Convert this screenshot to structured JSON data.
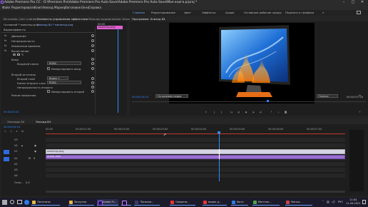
{
  "window": {
    "title": "Adobe Premiere Pro CC - D:\\Premiere Pro\\Adobe Premiere Pro Auto-Save\\Adobe Premiere Pro Auto-Save\\Моя книга.prproj *"
  },
  "menu": [
    "Файл",
    "Редактировать",
    "Клип",
    "Эпизод",
    "Маркер",
    "Заголовок",
    "Окно",
    "Справка"
  ],
  "workspaces": [
    "Главная",
    "Редактирование",
    "Цвет",
    "Эффекты",
    "Аудио",
    "Основные рабочие среды",
    "Подписи и графика"
  ],
  "left_panel": {
    "top_tabs": [
      "Источник: (нет клипов)",
      "Элементы управления эффектами",
      "Микшер аудиоклипов: Эпизод 84"
    ],
    "sub_tabs": [
      "Основной * монитор.png",
      "Эпизод 84 * монитор.png"
    ],
    "clip_label": "монитор.png",
    "ruler_time": "00:00",
    "section": "Видеоэффекты",
    "effects": [
      {
        "name": "Движение"
      },
      {
        "name": "Непрозрачность"
      },
      {
        "name": "Изменение времени"
      },
      {
        "name": "Вычисления"
      }
    ],
    "sub_effect_label": "Вход",
    "fields": [
      {
        "label": "Входной канал",
        "value": "RGBA"
      },
      {
        "label": "Инвертировать вход",
        "value": ""
      },
      {
        "label": "Второй источник",
        "value": ""
      },
      {
        "label": "Второй слой",
        "value": "Видео 1"
      },
      {
        "label": "Канал второго слоя",
        "value": "RGBA"
      },
      {
        "label": "Непрозрачность второго",
        "value": ""
      },
      {
        "label": "Инвертировать второй",
        "value": ""
      }
    ],
    "blend_mode": "Режим наложения",
    "bottom_time": "00:00:04:10"
  },
  "program_monitor": {
    "tab": "Программа: Эпизод 84",
    "timecode": "00:00:04:10",
    "fit": "По размеру кадра",
    "quality": "Полное",
    "duration": "00:00:07:20"
  },
  "timeline": {
    "tabs": [
      "Эпизоды 84",
      "Эпизод 84"
    ],
    "timecode": "00:00:04:10",
    "ruler": [
      "00:00",
      "00:00:01:00",
      "00:00:02:00",
      "00:00:03:00",
      "00:00:04:00",
      "00:00:05:00",
      "00:00:06:00",
      "00:00:07:00"
    ],
    "tracks": [
      {
        "id": "V3",
        "type": "video"
      },
      {
        "id": "V2",
        "type": "video"
      },
      {
        "id": "V1",
        "type": "video"
      },
      {
        "id": "A1",
        "type": "audio"
      },
      {
        "id": "A2",
        "type": "audio"
      },
      {
        "id": "A3",
        "type": "audio"
      },
      {
        "id": "A4",
        "type": "audio"
      }
    ],
    "clips": [
      {
        "label": "монитор.png",
        "track": "V2"
      },
      {
        "label": "огонь.mov",
        "track": "V1"
      }
    ],
    "master": "Осно...",
    "master_value": "0.0"
  },
  "taskbar": {
    "items": [
      "Логотипы",
      "Загрузки",
      "Adobe Pr...",
      "Ae",
      "\"Безымя...",
      "Сведени...",
      "видео д...",
      "Фото",
      "Монтаж...",
      "Монки..."
    ],
    "lang": "РУС",
    "time": "11:04",
    "date": "11.04.2021"
  },
  "colors": {
    "accent": "#2d8cff",
    "playhead": "#2d8cff",
    "video_clip": "#d6d2e6",
    "fire_clip": "#9b6fd1",
    "label_pink": "#e05fd0"
  }
}
